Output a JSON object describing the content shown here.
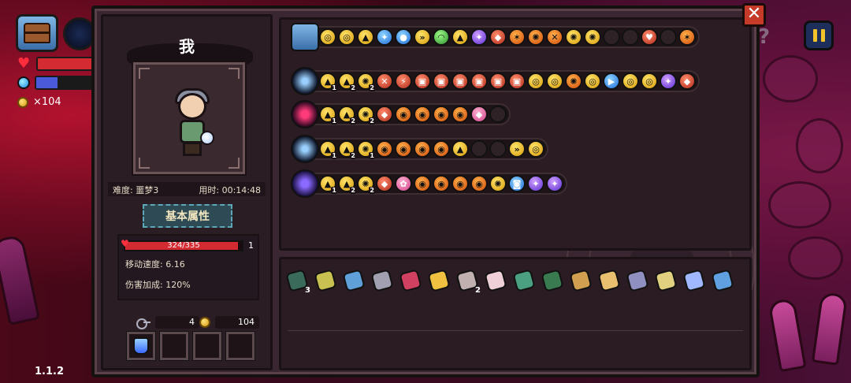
{
  "hud": {
    "coins": "×104",
    "version": "1.1.2",
    "hp_fraction": 0.97,
    "mana_fraction": 0.35,
    "help_glyph": "?",
    "pause_label": "II"
  },
  "close_label": "✕",
  "profile": {
    "name": "我",
    "difficulty": "难度: 噩梦3",
    "time": "用时: 00:14:48",
    "section_title": "基本属性",
    "hp_text": "324/335",
    "hp_fraction": 0.967,
    "hp_extra": "1",
    "move_speed": "移动速度: 6.16",
    "damage_bonus": "伤害加成: 120%",
    "keys": "4",
    "coins": "104"
  },
  "weapon_rows": [
    {
      "weapon": "chest-icon",
      "chips": [
        {
          "color": "yellow",
          "glyph": "◎"
        },
        {
          "color": "yellow",
          "glyph": "◎"
        },
        {
          "color": "yellow",
          "glyph": "▲"
        },
        {
          "color": "blue",
          "glyph": "✦"
        },
        {
          "color": "blue",
          "glyph": "●"
        },
        {
          "color": "yellow",
          "glyph": "»"
        },
        {
          "color": "green",
          "glyph": "◠"
        },
        {
          "color": "yellow",
          "glyph": "▲"
        },
        {
          "color": "purple",
          "glyph": "✦"
        },
        {
          "color": "red",
          "glyph": "◆"
        },
        {
          "color": "orange",
          "glyph": "✶"
        },
        {
          "color": "orange",
          "glyph": "✺"
        },
        {
          "color": "orange",
          "glyph": "✕"
        },
        {
          "color": "yellow",
          "glyph": "✺"
        },
        {
          "color": "yellow",
          "glyph": "✺"
        },
        {
          "color": "dark",
          "glyph": ""
        },
        {
          "color": "dark",
          "glyph": ""
        },
        {
          "color": "red",
          "glyph": "♥"
        },
        {
          "color": "dark",
          "glyph": ""
        },
        {
          "color": "orange",
          "glyph": "✶"
        }
      ]
    },
    {
      "weapon": "star-wand-icon",
      "chips": [
        {
          "color": "yellow",
          "glyph": "▲",
          "lv": "1"
        },
        {
          "color": "yellow",
          "glyph": "▲",
          "lv": "2"
        },
        {
          "color": "yellow",
          "glyph": "✺",
          "lv": "2"
        },
        {
          "color": "red",
          "glyph": "✕"
        },
        {
          "color": "red",
          "glyph": "⚡"
        },
        {
          "color": "red",
          "glyph": "▣"
        },
        {
          "color": "red",
          "glyph": "▣"
        },
        {
          "color": "red",
          "glyph": "▣"
        },
        {
          "color": "red",
          "glyph": "▣"
        },
        {
          "color": "red",
          "glyph": "▣"
        },
        {
          "color": "red",
          "glyph": "▣"
        },
        {
          "color": "yellow",
          "glyph": "◎"
        },
        {
          "color": "yellow",
          "glyph": "◎"
        },
        {
          "color": "orange",
          "glyph": "✺"
        },
        {
          "color": "yellow",
          "glyph": "◎"
        },
        {
          "color": "blue",
          "glyph": "▶"
        },
        {
          "color": "yellow",
          "glyph": "◎"
        },
        {
          "color": "yellow",
          "glyph": "◎"
        },
        {
          "color": "purple",
          "glyph": "✦"
        },
        {
          "color": "red",
          "glyph": "◆"
        }
      ]
    },
    {
      "weapon": "red-gem-icon",
      "chips": [
        {
          "color": "yellow",
          "glyph": "▲",
          "lv": "1"
        },
        {
          "color": "yellow",
          "glyph": "▲",
          "lv": "2"
        },
        {
          "color": "yellow",
          "glyph": "✺",
          "lv": "2"
        },
        {
          "color": "red",
          "glyph": "◆"
        },
        {
          "color": "orange",
          "glyph": "◉"
        },
        {
          "color": "orange",
          "glyph": "◉"
        },
        {
          "color": "orange",
          "glyph": "◉"
        },
        {
          "color": "orange",
          "glyph": "◉"
        },
        {
          "color": "pink",
          "glyph": "◆"
        },
        {
          "color": "dark",
          "glyph": ""
        }
      ]
    },
    {
      "weapon": "star-icon",
      "chips": [
        {
          "color": "yellow",
          "glyph": "▲",
          "lv": "1"
        },
        {
          "color": "yellow",
          "glyph": "▲",
          "lv": "2"
        },
        {
          "color": "yellow",
          "glyph": "✺",
          "lv": "1"
        },
        {
          "color": "orange",
          "glyph": "◉"
        },
        {
          "color": "orange",
          "glyph": "◉"
        },
        {
          "color": "orange",
          "glyph": "◉"
        },
        {
          "color": "orange",
          "glyph": "◉"
        },
        {
          "color": "yellow",
          "glyph": "▲"
        },
        {
          "color": "dark",
          "glyph": ""
        },
        {
          "color": "dark",
          "glyph": ""
        },
        {
          "color": "yellow",
          "glyph": "»"
        },
        {
          "color": "yellow",
          "glyph": "◎"
        }
      ]
    },
    {
      "weapon": "vortex-icon",
      "chips": [
        {
          "color": "yellow",
          "glyph": "▲",
          "lv": "1"
        },
        {
          "color": "yellow",
          "glyph": "▲",
          "lv": "2"
        },
        {
          "color": "yellow",
          "glyph": "✺",
          "lv": "2"
        },
        {
          "color": "red",
          "glyph": "◆"
        },
        {
          "color": "pink",
          "glyph": "✿"
        },
        {
          "color": "orange",
          "glyph": "◉"
        },
        {
          "color": "orange",
          "glyph": "◉"
        },
        {
          "color": "orange",
          "glyph": "◉"
        },
        {
          "color": "orange",
          "glyph": "◉"
        },
        {
          "color": "yellow",
          "glyph": "✺"
        },
        {
          "color": "blue",
          "glyph": "◙"
        },
        {
          "color": "purple",
          "glyph": "✦"
        },
        {
          "color": "purple",
          "glyph": "✦"
        }
      ]
    }
  ],
  "items": [
    {
      "name": "cloak-icon",
      "color": "#3a6a5a",
      "qty": "3"
    },
    {
      "name": "worm-icon",
      "color": "#c8c050",
      "qty": ""
    },
    {
      "name": "fish-icon",
      "color": "#60a0d8",
      "qty": ""
    },
    {
      "name": "rod-icon",
      "color": "#a0a0b0",
      "qty": ""
    },
    {
      "name": "ruby-pendant-icon",
      "color": "#d04060",
      "qty": ""
    },
    {
      "name": "cheese-icon",
      "color": "#f0c040",
      "qty": ""
    },
    {
      "name": "bone-icon",
      "color": "#c0b0b0",
      "qty": "2"
    },
    {
      "name": "feather-icon",
      "color": "#f0d0d8",
      "qty": ""
    },
    {
      "name": "rune-tile-icon",
      "color": "#4aa080",
      "qty": ""
    },
    {
      "name": "boot-icon",
      "color": "#3a7a50",
      "qty": ""
    },
    {
      "name": "scroll-icon",
      "color": "#d0a050",
      "qty": ""
    },
    {
      "name": "roast-icon",
      "color": "#e8c070",
      "qty": ""
    },
    {
      "name": "crystal-icon",
      "color": "#9090c0",
      "qty": ""
    },
    {
      "name": "fangs-icon",
      "color": "#e0d080",
      "qty": ""
    },
    {
      "name": "lotus-icon",
      "color": "#a0b8ff",
      "qty": ""
    },
    {
      "name": "magnifier-icon",
      "color": "#60a0e0",
      "qty": ""
    }
  ]
}
